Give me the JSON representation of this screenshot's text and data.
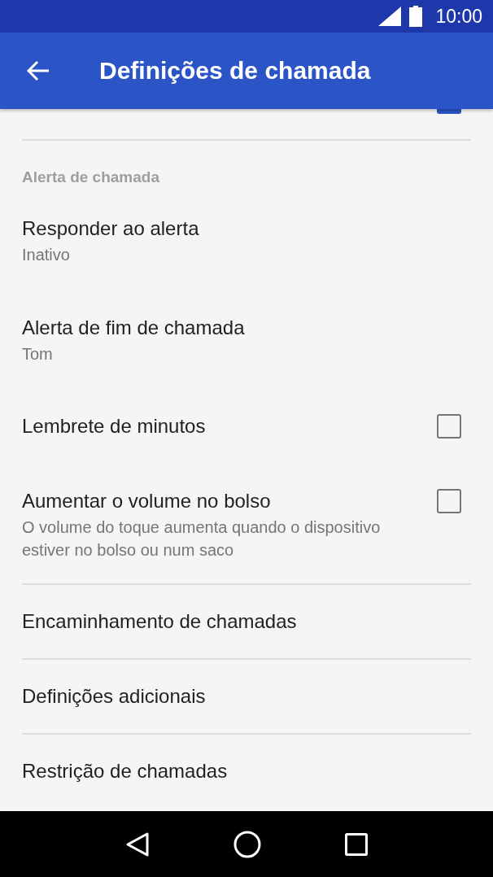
{
  "status_bar": {
    "time": "10:00"
  },
  "app_bar": {
    "title": "Definições de chamada"
  },
  "hidden_item": {
    "checked": true
  },
  "section": {
    "title": "Alerta de chamada"
  },
  "items": [
    {
      "kind": "summary",
      "title": "Responder ao alerta",
      "summary": "Inativo"
    },
    {
      "kind": "summary",
      "title": "Alerta de fim de chamada",
      "summary": "Tom"
    },
    {
      "kind": "checkbox",
      "title": "Lembrete de minutos",
      "checked": false
    },
    {
      "kind": "checkbox",
      "title": "Aumentar o volume no bolso",
      "summary": "O volume do toque aumenta quando o dispositivo estiver no bolso ou num saco",
      "checked": false
    },
    {
      "kind": "link",
      "title": "Encaminhamento de chamadas"
    },
    {
      "kind": "link",
      "title": "Definições adicionais"
    },
    {
      "kind": "link",
      "title": "Restrição de chamadas"
    }
  ]
}
